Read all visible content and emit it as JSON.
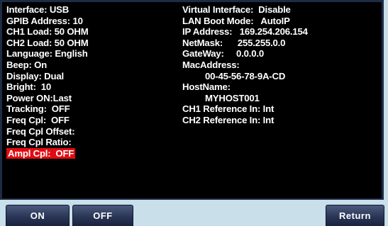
{
  "left_lines": [
    "Interface: USB",
    "GPIB Address: 10",
    "CH1 Load: 50 OHM",
    "CH2 Load: 50 OHM",
    "Language: English",
    "Beep: On",
    "Display: Dual",
    "Bright:  10",
    "Power ON:Last",
    "Tracking:  OFF",
    "Freq Cpl:  OFF",
    "Freq Cpl Offset:",
    "Freq Cpl Ratio:",
    "Ampl Cpl:  OFF"
  ],
  "right_lines": [
    "Virtual Interface:  Disable",
    "LAN Boot Mode:   AutoIP",
    "IP Address:   169.254.206.154",
    "NetMask:      255.255.0.0",
    "GateWay:     0.0.0.0",
    "MacAddress:",
    "00-45-56-78-9A-CD",
    "HostName:",
    "MYHOST001",
    "CH1 Reference In: Int",
    "CH2 Reference In: Int"
  ],
  "softkeys": {
    "on": "ON",
    "off": "OFF",
    "return": "Return"
  },
  "colors": {
    "highlight": "#e10b12",
    "screen_bg": "#000000",
    "softkey_bg": "#2a3656",
    "bar_bg": "#c9dfe9"
  }
}
